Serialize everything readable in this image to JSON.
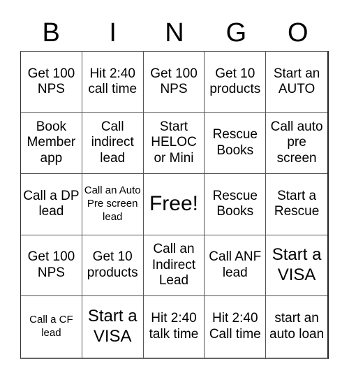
{
  "header": {
    "letters": [
      "B",
      "I",
      "N",
      "G",
      "O"
    ]
  },
  "cells": [
    {
      "text": "Get 100 NPS",
      "size": "md"
    },
    {
      "text": "Hit 2:40 call time",
      "size": "md"
    },
    {
      "text": "Get 100 NPS",
      "size": "md"
    },
    {
      "text": "Get 10 products",
      "size": "md"
    },
    {
      "text": "Start an AUTO",
      "size": "md"
    },
    {
      "text": "Book Member app",
      "size": "md"
    },
    {
      "text": "Call indirect lead",
      "size": "md"
    },
    {
      "text": "Start HELOC or Mini",
      "size": "md"
    },
    {
      "text": "Rescue Books",
      "size": "md"
    },
    {
      "text": "Call auto pre screen",
      "size": "md"
    },
    {
      "text": "Call a DP lead",
      "size": "md"
    },
    {
      "text": "Call an Auto Pre screen lead",
      "size": "sm"
    },
    {
      "text": "Free!",
      "size": "free"
    },
    {
      "text": "Rescue Books",
      "size": "md"
    },
    {
      "text": "Start a Rescue",
      "size": "md"
    },
    {
      "text": "Get 100 NPS",
      "size": "md"
    },
    {
      "text": "Get 10 products",
      "size": "md"
    },
    {
      "text": "Call an Indirect Lead",
      "size": "md"
    },
    {
      "text": "Call ANF lead",
      "size": "md"
    },
    {
      "text": "Start a VISA",
      "size": "lg"
    },
    {
      "text": "Call a CF lead",
      "size": "sm"
    },
    {
      "text": "Start a VISA",
      "size": "lg"
    },
    {
      "text": "Hit 2:40 talk time",
      "size": "md"
    },
    {
      "text": "Hit 2:40 Call time",
      "size": "md"
    },
    {
      "text": "start an auto loan",
      "size": "md"
    }
  ]
}
